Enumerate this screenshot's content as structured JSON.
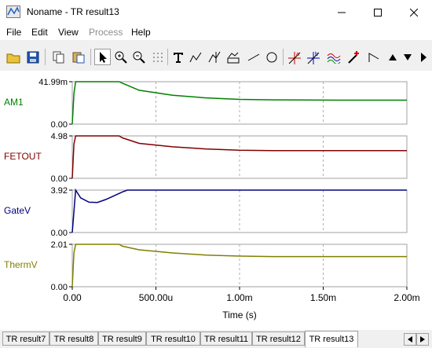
{
  "window": {
    "title": "Noname - TR result13"
  },
  "menu": [
    "File",
    "Edit",
    "View",
    "Process",
    "Help"
  ],
  "toolbar_icons": [
    "open-folder-icon",
    "save-disk-icon",
    "copy-icon",
    "paste-icon",
    "pointer-icon",
    "zoom-in-icon",
    "zoom-100-icon",
    "grid-dots-icon",
    "text-tool-icon",
    "signal-tool-icon",
    "cursor-tool-icon",
    "graph-tool-icon",
    "line-tool-icon",
    "circle-tool-icon",
    "cursor-a-icon",
    "cursor-b-icon",
    "curve-icon",
    "probe-icon",
    "ramp-icon",
    "arrow-up-icon",
    "arrow-down-icon",
    "more-icon"
  ],
  "chart_data": {
    "type": "line",
    "xlabel": "Time (s)",
    "x_ticks": [
      "0.00",
      "500.00u",
      "1.00m",
      "1.50m",
      "2.00m"
    ],
    "xlim": [
      0,
      0.002
    ],
    "x_unit": "s",
    "grid": "vertical dashed",
    "panels": [
      {
        "name": "AM1",
        "y_top": "41.99m",
        "y_bottom": "0.00",
        "color": "#008000",
        "points": [
          [
            0,
            0
          ],
          [
            1e-05,
            0.03
          ],
          [
            2e-05,
            0.042
          ],
          [
            0.00028,
            0.042
          ],
          [
            0.0003,
            0.0405
          ],
          [
            0.0004,
            0.0335
          ],
          [
            0.0006,
            0.0285
          ],
          [
            0.0008,
            0.026
          ],
          [
            0.001,
            0.0245
          ],
          [
            0.0012,
            0.024
          ],
          [
            0.0016,
            0.0237
          ],
          [
            0.002,
            0.0237
          ]
        ]
      },
      {
        "name": "FETOUT",
        "y_top": "4.98",
        "y_bottom": "0.00",
        "color": "#800000",
        "points": [
          [
            0,
            0
          ],
          [
            1e-05,
            4.0
          ],
          [
            2e-05,
            4.98
          ],
          [
            0.00028,
            4.98
          ],
          [
            0.0003,
            4.75
          ],
          [
            0.0004,
            4.1
          ],
          [
            0.0006,
            3.7
          ],
          [
            0.0008,
            3.45
          ],
          [
            0.001,
            3.3
          ],
          [
            0.0012,
            3.25
          ],
          [
            0.0016,
            3.25
          ],
          [
            0.002,
            3.25
          ]
        ]
      },
      {
        "name": "GateV",
        "y_top": "3.92",
        "y_bottom": "0.00",
        "color": "#000080",
        "points": [
          [
            0,
            0
          ],
          [
            2e-05,
            3.92
          ],
          [
            5e-05,
            3.2
          ],
          [
            0.0001,
            2.8
          ],
          [
            0.00015,
            2.78
          ],
          [
            0.0002,
            3.05
          ],
          [
            0.00025,
            3.4
          ],
          [
            0.0003,
            3.75
          ],
          [
            0.00033,
            3.92
          ],
          [
            0.002,
            3.92
          ]
        ]
      },
      {
        "name": "ThermV",
        "y_top": "2.01",
        "y_bottom": "0.00",
        "color": "#808000",
        "points": [
          [
            0,
            0
          ],
          [
            1e-05,
            1.6
          ],
          [
            2e-05,
            2.01
          ],
          [
            0.00028,
            2.01
          ],
          [
            0.0003,
            1.92
          ],
          [
            0.0004,
            1.75
          ],
          [
            0.0006,
            1.6
          ],
          [
            0.0008,
            1.5
          ],
          [
            0.001,
            1.45
          ],
          [
            0.0012,
            1.43
          ],
          [
            0.0016,
            1.43
          ],
          [
            0.002,
            1.43
          ]
        ]
      }
    ]
  },
  "tabs": [
    "TR result7",
    "TR result8",
    "TR result9",
    "TR result10",
    "TR result11",
    "TR result12",
    "TR result13"
  ],
  "active_tab": "TR result13"
}
